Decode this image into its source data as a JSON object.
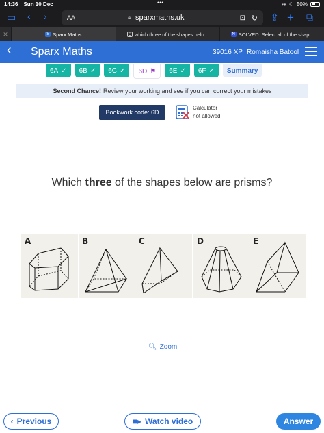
{
  "statusbar": {
    "time": "14:36",
    "date": "Sun 10 Dec",
    "battery": "50%"
  },
  "browser": {
    "aa": "AA",
    "url": "sparxmaths.uk",
    "tabs": [
      {
        "label": "Sparx Maths",
        "active": true
      },
      {
        "label": "which three of the shapes belo...",
        "active": false
      },
      {
        "label": "SOLVED: Select all of the shap...",
        "active": false
      }
    ]
  },
  "header": {
    "title": "Sparx Maths",
    "xp": "39016 XP",
    "user": "Romaisha Batool"
  },
  "tasks": [
    {
      "label": "6A",
      "done": true
    },
    {
      "label": "6B",
      "done": true
    },
    {
      "label": "6C",
      "done": true
    },
    {
      "label": "6D",
      "done": false,
      "current": true
    },
    {
      "label": "6E",
      "done": true
    },
    {
      "label": "6F",
      "done": true
    }
  ],
  "summary_label": "Summary",
  "second_chance": {
    "bold": "Second Chance!",
    "text": "Review your working and see if you can correct your mistakes"
  },
  "bookwork": "Bookwork code: 6D",
  "calculator": {
    "line1": "Calculator",
    "line2": "not allowed"
  },
  "question": {
    "before": "Which ",
    "bold": "three",
    "after": " of the shapes below are prisms?"
  },
  "shapes": [
    "A",
    "B",
    "C",
    "D",
    "E"
  ],
  "zoom_label": "Zoom",
  "buttons": {
    "previous": "Previous",
    "watch": "Watch video",
    "answer": "Answer"
  },
  "colors": {
    "brand": "#2e6fd6",
    "task_done": "#16b4a2",
    "task_current": "#9a35c9",
    "bookwork": "#223a66"
  }
}
